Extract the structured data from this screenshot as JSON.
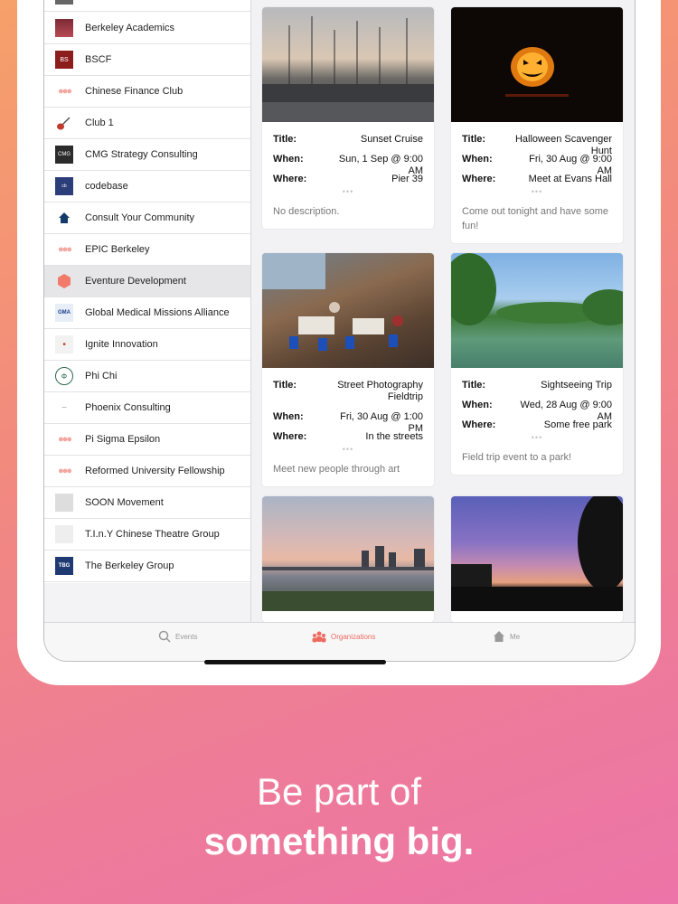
{
  "sidebar": {
    "items": [
      {
        "label": "Berkeley Academics",
        "logo": "berkeley-academics-logo"
      },
      {
        "label": "BSCF",
        "logo": "bscf-logo"
      },
      {
        "label": "Chinese Finance Club",
        "logo": "people-icon"
      },
      {
        "label": "Club 1",
        "logo": "guitar-icon"
      },
      {
        "label": "CMG Strategy Consulting",
        "logo": "cmg-logo"
      },
      {
        "label": "codebase",
        "logo": "codebase-logo"
      },
      {
        "label": "Consult Your Community",
        "logo": "house-icon"
      },
      {
        "label": "EPIC Berkeley",
        "logo": "people-icon"
      },
      {
        "label": "Eventure Development",
        "logo": "hexagon-logo",
        "selected": true
      },
      {
        "label": "Global Medical Missions Alliance",
        "logo": "gmma-logo"
      },
      {
        "label": "Ignite Innovation",
        "logo": "ignite-logo"
      },
      {
        "label": "Phi Chi",
        "logo": "phi-chi-logo"
      },
      {
        "label": "Phoenix Consulting",
        "logo": "phoenix-logo"
      },
      {
        "label": "Pi Sigma Epsilon",
        "logo": "people-icon"
      },
      {
        "label": "Reformed University Fellowship",
        "logo": "people-icon"
      },
      {
        "label": "SOON Movement",
        "logo": "soon-logo"
      },
      {
        "label": "T.I.n.Y Chinese Theatre Group",
        "logo": "tiny-logo"
      },
      {
        "label": "The Berkeley Group",
        "logo": "tbg-logo"
      }
    ]
  },
  "events": [
    {
      "title_label": "Title:",
      "title": "Sunset Cruise",
      "when_label": "When:",
      "when": "Sun, 1 Sep @ 9:00 AM",
      "where_label": "Where:",
      "where": "Pier 39",
      "description": "No description.",
      "photo": "marina-sunset"
    },
    {
      "title_label": "Title:",
      "title": "Halloween Scavenger Hunt",
      "when_label": "When:",
      "when": "Fri, 30 Aug @ 9:00 AM",
      "where_label": "Where:",
      "where": "Meet at Evans Hall",
      "description": "Come out tonight and have some fun!",
      "photo": "jack-o-lantern"
    },
    {
      "title_label": "Title:",
      "title": "Street Photography Fieldtrip",
      "when_label": "When:",
      "when": "Fri, 30 Aug @ 1:00 PM",
      "where_label": "Where:",
      "where": "In the streets",
      "description": "Meet new people through art",
      "photo": "pier-restaurant"
    },
    {
      "title_label": "Title:",
      "title": "Sightseeing Trip",
      "when_label": "When:",
      "when": "Wed, 28 Aug @ 9:00 AM",
      "where_label": "Where:",
      "where": "Some free park",
      "description": "Field trip event to a park!",
      "photo": "park-lake"
    },
    {
      "photo": "lake-city-sunset"
    },
    {
      "photo": "purple-sunset"
    }
  ],
  "tabbar": {
    "events": "Events",
    "organizations": "Organizations",
    "me": "Me"
  },
  "tagline": {
    "line1": "Be part of",
    "line2": "something big."
  },
  "colors": {
    "accent": "#ee6a5e",
    "gradient_start": "#f6a06a",
    "gradient_end": "#ec74a8"
  }
}
